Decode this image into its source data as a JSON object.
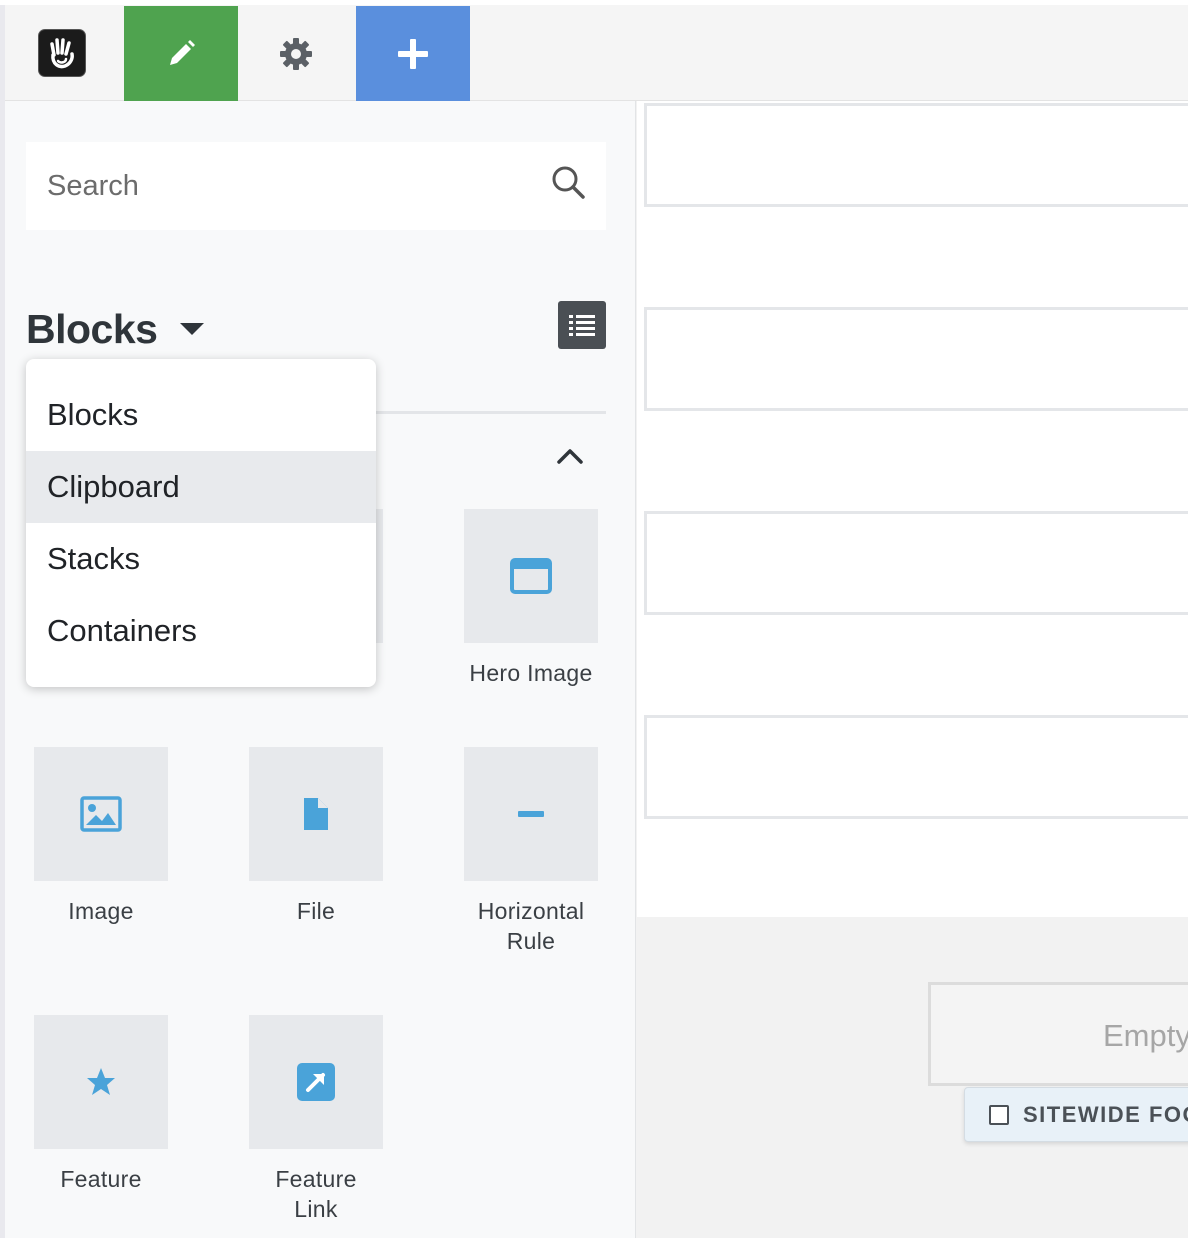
{
  "toolbar": {
    "logo_icon": "concrete-cms-hand-logo",
    "edit_icon": "pencil-icon",
    "settings_icon": "gear-icon",
    "add_icon": "plus-icon",
    "colors": {
      "edit": "#4fa34f",
      "add": "#5a8fdd"
    }
  },
  "panel": {
    "search": {
      "placeholder": "Search",
      "value": ""
    },
    "section_title": "Blocks",
    "dropdown": {
      "items": [
        {
          "label": "Blocks",
          "active": false
        },
        {
          "label": "Clipboard",
          "active": true
        },
        {
          "label": "Stacks",
          "active": false
        },
        {
          "label": "Containers",
          "active": false
        }
      ]
    },
    "tiles": [
      {
        "label": "Hero Image",
        "icon": "browser-window-icon"
      },
      {
        "label": "Image",
        "icon": "image-icon"
      },
      {
        "label": "File",
        "icon": "file-icon"
      },
      {
        "label": "Horizontal\nRule",
        "icon": "minus-icon"
      },
      {
        "label": "Feature",
        "icon": "star-icon"
      },
      {
        "label": "Feature\nLink",
        "icon": "external-link-icon"
      }
    ]
  },
  "page": {
    "footer_area_placeholder": "Empty",
    "footer_tag": "SITEWIDE FOO"
  }
}
